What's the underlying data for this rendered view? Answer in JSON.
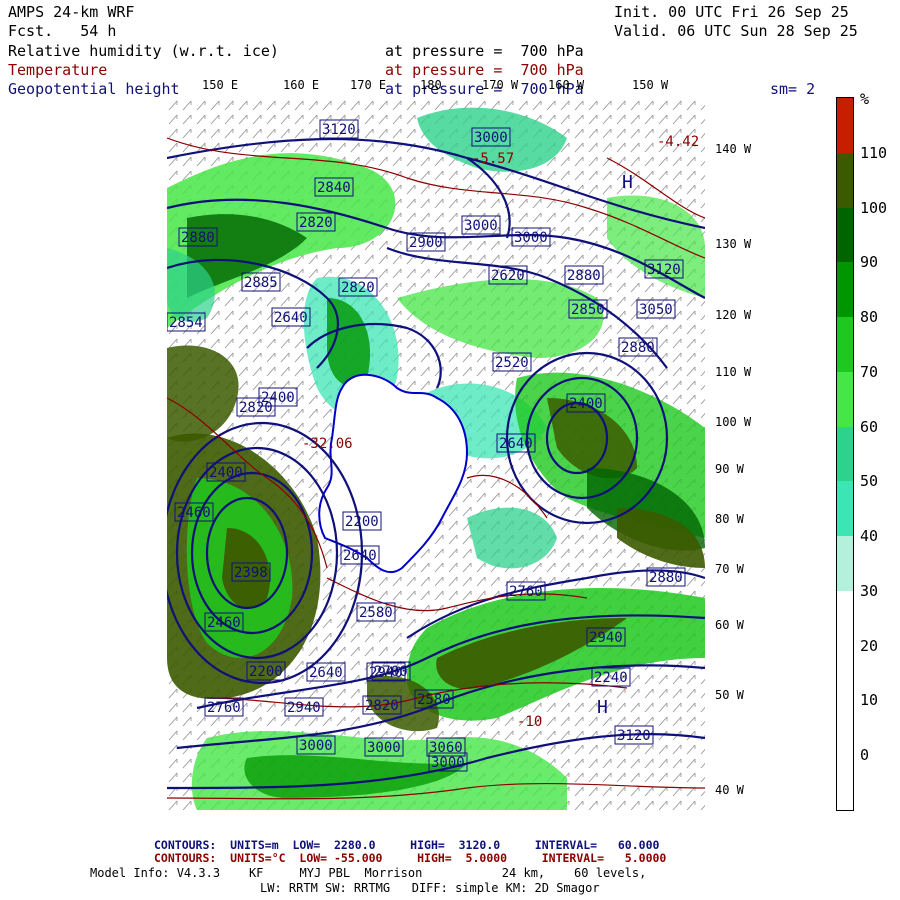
{
  "header": {
    "model": "AMPS 24-km WRF",
    "forecast": "Fcst.   54 h",
    "init": "Init. 00 UTC Fri 26 Sep 25",
    "valid": "Valid. 06 UTC Sun 28 Sep 25",
    "field1": "Relative humidity (w.r.t. ice)",
    "field1_level": "at pressure =  700 hPa",
    "field2": "Temperature",
    "field2_level": "at pressure =  700 hPa",
    "field3": "Geopotential height",
    "field3_level": "at pressure =  700 hPa",
    "smoothing": "sm= 2"
  },
  "longitude_labels": [
    "150 E",
    "160 E",
    "170 E",
    "180",
    "170 W",
    "160 W",
    "150 W"
  ],
  "latitude_labels": [
    "140 W",
    "130 W",
    "120 W",
    "110 W",
    "100 W",
    "90 W",
    "80 W",
    "70 W",
    "60 W",
    "50 W",
    "40 W"
  ],
  "legend": {
    "unit": "%",
    "labels": [
      "110",
      "100",
      "90",
      "80",
      "70",
      "60",
      "50",
      "40",
      "30",
      "20",
      "10",
      "0"
    ],
    "colors": [
      "#c81e00",
      "#3c5a00",
      "#006400",
      "#009600",
      "#1ec81e",
      "#46e646",
      "#2dd28c",
      "#3ce6b4",
      "#b4f0dc",
      "#ffffff",
      "#ffffff",
      "#ffffff",
      "#ffffff"
    ]
  },
  "map": {
    "height_labels": [
      "3120",
      "3000",
      "2840",
      "2820",
      "2880",
      "3000",
      "2820",
      "2900",
      "3000",
      "2620",
      "2880",
      "3120",
      "2885",
      "2854",
      "2640",
      "2820",
      "2850",
      "3050",
      "2520",
      "2880",
      "2400",
      "2400",
      "2400",
      "2640",
      "2460",
      "2200",
      "2640",
      "2398",
      "2580",
      "2760",
      "2460",
      "2940",
      "2200",
      "2640",
      "2700",
      "2580",
      "2820",
      "3000",
      "3060",
      "2240",
      "2760",
      "2940",
      "3000",
      "3000",
      "2880",
      "3120",
      "2940"
    ],
    "temp_labels": [
      "-4.42",
      "-32.06",
      "-5.57",
      "-10"
    ],
    "high_marks": [
      "H",
      "H"
    ],
    "colors": {
      "height_contour": "#10107a",
      "temp_contour": "#8b0000",
      "coast": "#0000c8"
    }
  },
  "footer": {
    "contours_height": "CONTOURS:  UNITS=m  LOW=  2280.0     HIGH=  3120.0     INTERVAL=   60.000",
    "contours_temp": "CONTOURS:  UNITS=°C  LOW= -55.000     HIGH=  5.0000     INTERVAL=   5.0000",
    "model_info": "Model Info: V4.3.3    KF     MYJ PBL  Morrison           24 km,    60 levels,",
    "model_info2": "LW: RRTM SW: RRTMG   DIFF: simple KM: 2D Smagor"
  }
}
